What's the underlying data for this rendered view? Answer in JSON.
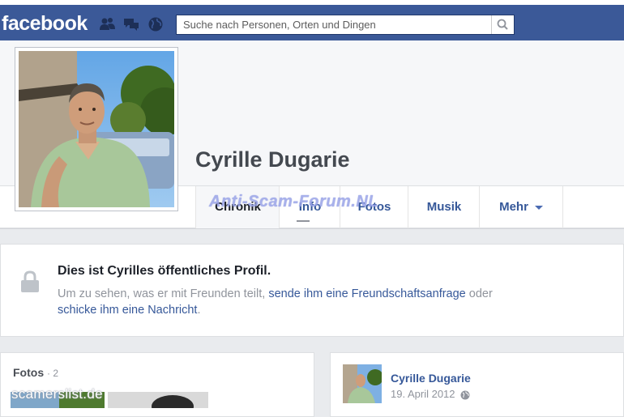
{
  "header": {
    "logo": "facebook",
    "search_placeholder": "Suche nach Personen, Orten und Dingen",
    "icons": [
      "friends-icon",
      "messages-icon",
      "notifications-globe-icon",
      "search-icon"
    ]
  },
  "profile": {
    "name": "Cyrille Dugarie",
    "tabs": [
      {
        "label": "Chronik",
        "active": true
      },
      {
        "label": "Info"
      },
      {
        "label": "Fotos"
      },
      {
        "label": "Musik"
      },
      {
        "label": "Mehr"
      }
    ]
  },
  "watermark": "Anti-Scam-Forum.NL",
  "privacy": {
    "title": "Dies ist Cyrilles öffentliches Profil.",
    "text_1": "Um zu sehen, was er mit Freunden teilt, ",
    "link_1": "sende ihm eine Freundschaftsanfrage",
    "text_2": " oder ",
    "link_2": "schicke ihm eine Nachricht",
    "text_3": "."
  },
  "photos": {
    "title": "Fotos",
    "count": "· 2"
  },
  "post": {
    "author": "Cyrille Dugarie",
    "date": "19. April 2012"
  },
  "corner_watermark": "scamerslist.de",
  "colors": {
    "brand": "#3b5998",
    "link": "#365899",
    "page_bg": "#e9ebee"
  }
}
